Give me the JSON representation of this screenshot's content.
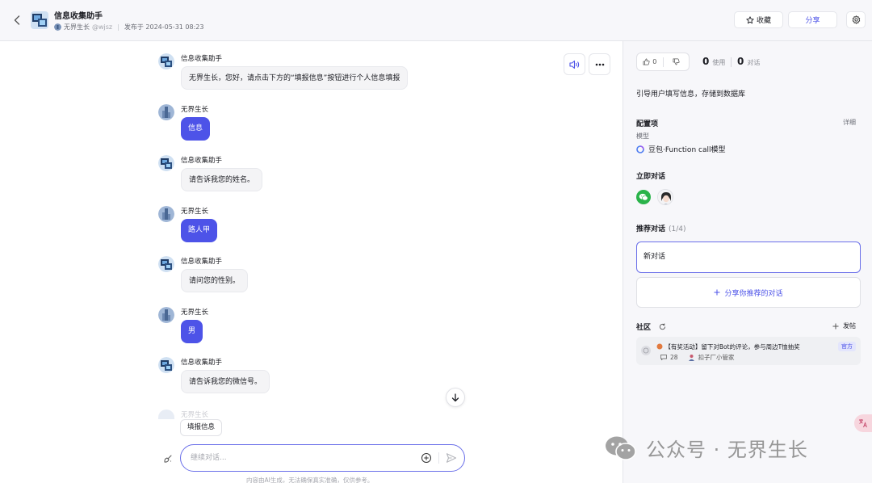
{
  "header": {
    "back_label": "‹",
    "bot_name": "信息收集助手",
    "author_name": "无界生长",
    "author_handle": "@wjsz",
    "published": "发布于 2024-05-31 08:23",
    "favorite_label": "收藏",
    "share_label": "分享"
  },
  "chat": {
    "messages": [
      {
        "sender": "信息收集助手",
        "role": "bot",
        "text": "无界生长，您好，请点击下方的“填报信息”按钮进行个人信息填报"
      },
      {
        "sender": "无界生长",
        "role": "user",
        "text": "信息"
      },
      {
        "sender": "信息收集助手",
        "role": "bot",
        "text": "请告诉我您的姓名。"
      },
      {
        "sender": "无界生长",
        "role": "user",
        "text": "路人甲"
      },
      {
        "sender": "信息收集助手",
        "role": "bot",
        "text": "请问您的性别。"
      },
      {
        "sender": "无界生长",
        "role": "user",
        "text": "男"
      },
      {
        "sender": "信息收集助手",
        "role": "bot",
        "text": "请告诉我您的微信号。"
      }
    ],
    "partial_sender": "无界生长",
    "quick_reply": "填报信息",
    "input_placeholder": "继续对话...",
    "disclaimer": "内容由AI生成，无法确保真实准确，仅供参考。"
  },
  "panel": {
    "likes": "0",
    "dislike_icon": "thumb-down-icon",
    "uses_count": "0",
    "uses_label": "使用",
    "convo_count": "0",
    "convo_label": "对话",
    "description": "引导用户填写信息，存储到数据库",
    "config_title": "配置项",
    "config_detail": "详细",
    "model_label": "模型",
    "model_name": "豆包·Function call模型",
    "instant_title": "立即对话",
    "recommended_title": "推荐对话",
    "recommended_count": "(1/4)",
    "recommended_item": "新对话",
    "share_recommended": "分享你推荐的对话",
    "community_title": "社区",
    "post_label": "发帖",
    "post": {
      "title": "【有奖活动】留下对Bot的评论，参与周边T恤抽奖",
      "badge": "官方",
      "comments": "28",
      "author": "扣子厂小管家"
    }
  },
  "watermark": "公众号 · 无界生长",
  "colors": {
    "accent": "#4d53e8",
    "user_bubble": "#4d53e8",
    "panel_bg": "#f7f7fa"
  }
}
